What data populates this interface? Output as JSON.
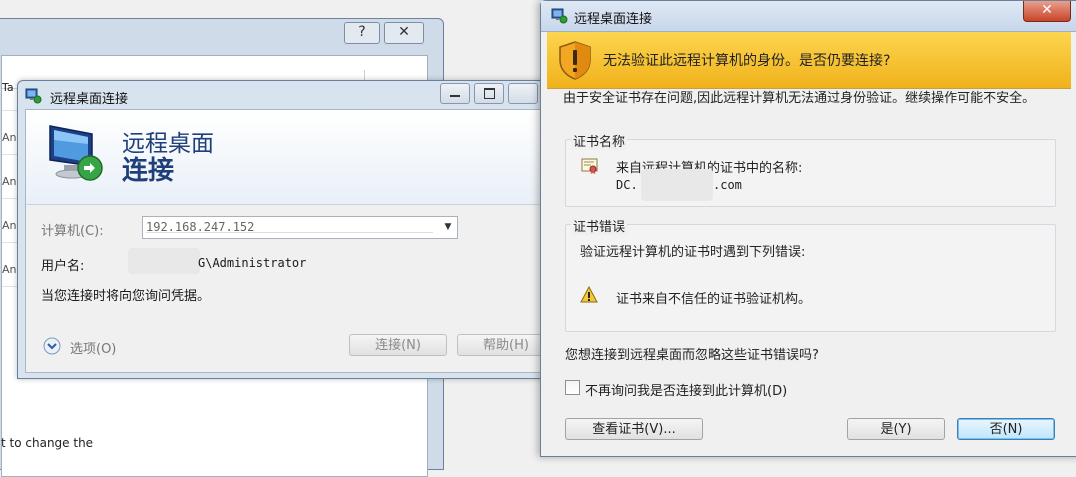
{
  "background_window": {
    "help_button": "?",
    "close_button": "✕",
    "partial_column_header": "Ta",
    "partial_rows": [
      "Any",
      "Any",
      "Any",
      "Any"
    ],
    "bottom_text": "t to change the"
  },
  "rdc_window": {
    "title": "远程桌面连接",
    "banner_line1": "远程桌面",
    "banner_line2": "连接",
    "computer_label": "计算机(C):",
    "computer_value": "192.168.247.152",
    "username_label": "用户名:",
    "username_value": "G\\Administrator",
    "credential_note": "当您连接时将向您询问凭据。",
    "options_label": "选项(O)",
    "connect_button": "连接(N)",
    "help_button": "帮助(H)"
  },
  "cert_dialog": {
    "title": "远程桌面连接",
    "close_button": "✕",
    "warning_message": "无法验证此远程计算机的身份。是否仍要连接?",
    "description": "由于安全证书存在问题,因此远程计算机无法通过身份验证。继续操作可能不安全。",
    "cert_name_group": "证书名称",
    "cert_name_caption": "来自远程计算机的证书中的名称:",
    "cert_name_prefix": "DC.",
    "cert_name_suffix": ".com",
    "cert_errors_group": "证书错误",
    "cert_errors_caption": "验证远程计算机的证书时遇到下列错误:",
    "cert_error_item": "证书来自不信任的证书验证机构。",
    "question": "您想连接到远程桌面而忽略这些证书错误吗?",
    "dont_ask_checkbox": "不再询问我是否连接到此计算机(D)",
    "dont_ask_checked": false,
    "view_cert_button": "查看证书(V)...",
    "yes_button": "是(Y)",
    "no_button": "否(N)"
  },
  "colors": {
    "warning_banner": "#f0b21b",
    "heading_blue": "#1e3f7a",
    "close_red": "#c8452a"
  },
  "icons": [
    "remote-desktop-icon",
    "shield-warning-icon",
    "certificate-icon",
    "warning-triangle-icon",
    "options-chevron-icon"
  ]
}
